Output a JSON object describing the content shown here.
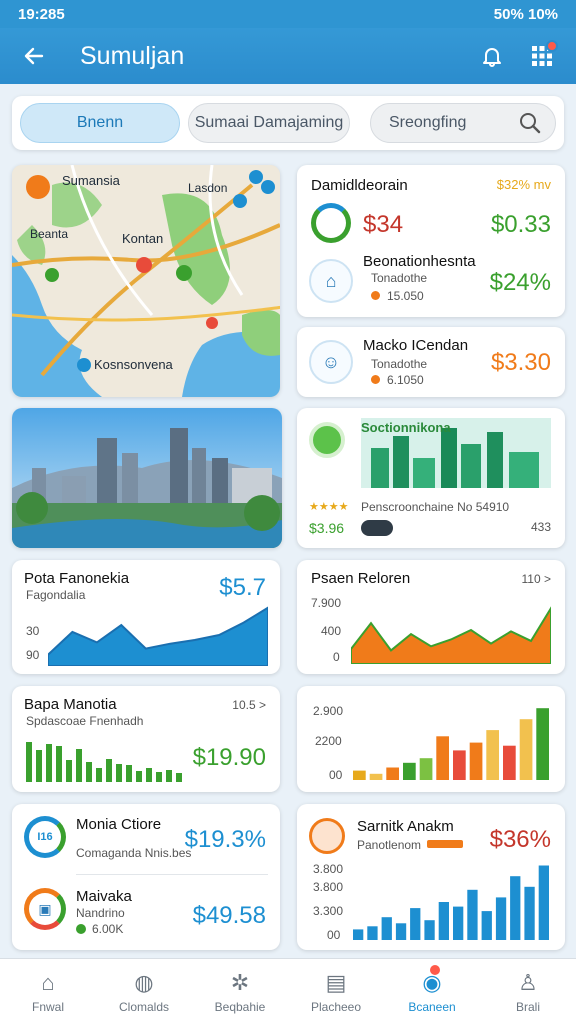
{
  "status": {
    "time": "19:285",
    "right": "50% 10%"
  },
  "appbar": {
    "title": "Sumuljan"
  },
  "search": {
    "tab1": "Bnenn",
    "tab2": "Sumaai Damajaming",
    "tab3": "Sreongfing"
  },
  "map": {
    "l1": "Sumansia",
    "l2": "Beanta",
    "l3": "Kontan",
    "l4": "Lasdon",
    "l5": "Kosnsonvena"
  },
  "fin_card": {
    "title": "Damidldeorain",
    "delta": "$32% mv",
    "val1": "$34",
    "val2": "$0.33",
    "item2_title": "Beonationhesnta",
    "item2_sub": "Tonadothe",
    "item2_small": "15.050",
    "item2_price": "$24%",
    "colors": {
      "green": "#3aa02e",
      "orange": "#f07b1a",
      "blue": "#1d8fd1"
    }
  },
  "macko": {
    "title": "Macko ICendan",
    "sub": "Tonadothe",
    "small": "6.1050",
    "price": "$3.30"
  },
  "section": {
    "title": "Soctionnikona",
    "stars": "★★★★",
    "value": "$3.96",
    "sub": "Penscroonchaine  No 54910",
    "right": "433"
  },
  "pota": {
    "title": "Pota Fanonekia",
    "sub": "Fagondalia",
    "price": "$5.7",
    "y1": "30",
    "y2": "90",
    "values": [
      18,
      55,
      38,
      66,
      28,
      36,
      42,
      50,
      70,
      94
    ]
  },
  "psaen": {
    "title": "Psaen Reloren",
    "corner": "110 >",
    "y1": "7.900",
    "y2": "400",
    "y3": "0",
    "values": [
      22,
      60,
      20,
      44,
      26,
      36,
      50,
      30,
      48,
      34,
      82
    ]
  },
  "bapa": {
    "title": "Bapa Manotia",
    "sub": "Spdascoae Fnenhadh",
    "corner": "10.5 >",
    "price": "$19.90",
    "values": [
      80,
      64,
      76,
      72,
      44,
      66,
      40,
      28,
      46,
      36,
      34,
      22,
      28,
      20,
      24,
      18
    ]
  },
  "bar2": {
    "y1": "2.900",
    "y2": "2200",
    "y3": "00",
    "values": [
      12,
      8,
      16,
      22,
      28,
      56,
      38,
      48,
      64,
      44,
      78,
      92
    ]
  },
  "monia": {
    "title": "Monia Ctiore",
    "sub": "Comaganda Nnis.bes",
    "pct": "$19.3%",
    "ring_label": "I16"
  },
  "maivaka": {
    "title": "Maivaka",
    "sub": "Nandrino",
    "small": "6.00K",
    "price": "$49.58"
  },
  "sarnitk": {
    "title": "Sarnitk Anakm",
    "sub": "Panotlenom",
    "pct": "$36%",
    "y1": "3.800",
    "y2": "3.800",
    "y3": "3.300",
    "y4": "00",
    "values": [
      14,
      18,
      30,
      22,
      42,
      26,
      50,
      44,
      66,
      38,
      56,
      84,
      70,
      98
    ]
  },
  "nav": {
    "i1": "Fnwal",
    "i2": "Clomalds",
    "i3": "Beqbahie",
    "i4": "Placheeo",
    "i5": "Bcaneen",
    "i6": "Brali"
  }
}
